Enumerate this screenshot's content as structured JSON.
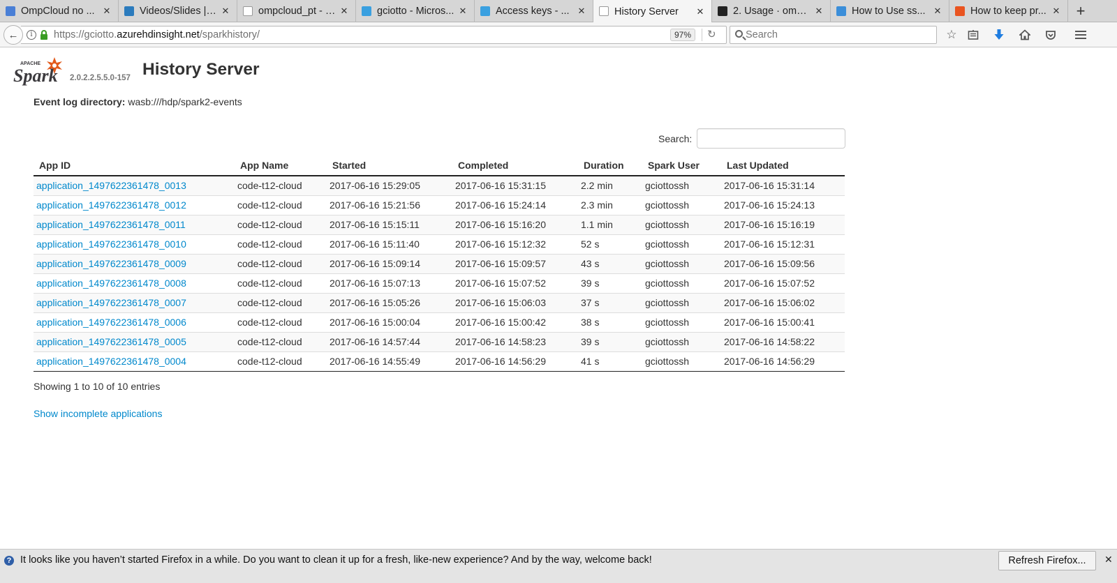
{
  "browser": {
    "tabs": [
      {
        "label": "OmpCloud no ...",
        "icon": "google-docs-icon",
        "color": "#4a7fd6",
        "active": false
      },
      {
        "label": "Videos/Slides | ...",
        "icon": "drupal-icon",
        "color": "#2b7bbd",
        "active": false
      },
      {
        "label": "ompcloud_pt - om...",
        "icon": "blank-page-icon",
        "color": "#ffffff",
        "active": false
      },
      {
        "label": "gciotto - Micros...",
        "icon": "azure-cloud-icon",
        "color": "#3aa0e0",
        "active": false
      },
      {
        "label": "Access keys - ...",
        "icon": "azure-cloud-icon",
        "color": "#3aa0e0",
        "active": false
      },
      {
        "label": "History Server",
        "icon": "blank-page-icon",
        "color": "#ffffff",
        "active": true
      },
      {
        "label": "2. Usage · omp...",
        "icon": "github-icon",
        "color": "#222222",
        "active": false
      },
      {
        "label": "How to Use ss...",
        "icon": "lock-doc-icon",
        "color": "#3b8ed9",
        "active": false
      },
      {
        "label": "How to keep pr...",
        "icon": "askubuntu-icon",
        "color": "#e95420",
        "active": false
      }
    ],
    "url_prefix": "https://gciotto.",
    "url_host": "azurehdinsight.net",
    "url_path": "/sparkhistory/",
    "zoom": "97%",
    "search_placeholder": "Search"
  },
  "page": {
    "spark_version": "2.0.2.2.5.5.0-157",
    "title": "History Server",
    "event_log_label": "Event log directory:",
    "event_log_value": "wasb:///hdp/spark2-events",
    "search_label": "Search:",
    "columns": [
      "App ID",
      "App Name",
      "Started",
      "Completed",
      "Duration",
      "Spark User",
      "Last Updated"
    ],
    "rows": [
      [
        "application_1497622361478_0013",
        "code-t12-cloud",
        "2017-06-16 15:29:05",
        "2017-06-16 15:31:15",
        "2.2 min",
        "gciottossh",
        "2017-06-16 15:31:14"
      ],
      [
        "application_1497622361478_0012",
        "code-t12-cloud",
        "2017-06-16 15:21:56",
        "2017-06-16 15:24:14",
        "2.3 min",
        "gciottossh",
        "2017-06-16 15:24:13"
      ],
      [
        "application_1497622361478_0011",
        "code-t12-cloud",
        "2017-06-16 15:15:11",
        "2017-06-16 15:16:20",
        "1.1 min",
        "gciottossh",
        "2017-06-16 15:16:19"
      ],
      [
        "application_1497622361478_0010",
        "code-t12-cloud",
        "2017-06-16 15:11:40",
        "2017-06-16 15:12:32",
        "52 s",
        "gciottossh",
        "2017-06-16 15:12:31"
      ],
      [
        "application_1497622361478_0009",
        "code-t12-cloud",
        "2017-06-16 15:09:14",
        "2017-06-16 15:09:57",
        "43 s",
        "gciottossh",
        "2017-06-16 15:09:56"
      ],
      [
        "application_1497622361478_0008",
        "code-t12-cloud",
        "2017-06-16 15:07:13",
        "2017-06-16 15:07:52",
        "39 s",
        "gciottossh",
        "2017-06-16 15:07:52"
      ],
      [
        "application_1497622361478_0007",
        "code-t12-cloud",
        "2017-06-16 15:05:26",
        "2017-06-16 15:06:03",
        "37 s",
        "gciottossh",
        "2017-06-16 15:06:02"
      ],
      [
        "application_1497622361478_0006",
        "code-t12-cloud",
        "2017-06-16 15:00:04",
        "2017-06-16 15:00:42",
        "38 s",
        "gciottossh",
        "2017-06-16 15:00:41"
      ],
      [
        "application_1497622361478_0005",
        "code-t12-cloud",
        "2017-06-16 14:57:44",
        "2017-06-16 14:58:23",
        "39 s",
        "gciottossh",
        "2017-06-16 14:58:22"
      ],
      [
        "application_1497622361478_0004",
        "code-t12-cloud",
        "2017-06-16 14:55:49",
        "2017-06-16 14:56:29",
        "41 s",
        "gciottossh",
        "2017-06-16 14:56:29"
      ]
    ],
    "showing_text": "Showing 1 to 10 of 10 entries",
    "incomplete_link": "Show incomplete applications",
    "link_color": "#0088cc"
  },
  "notification": {
    "message": "It looks like you haven’t started Firefox in a while. Do you want to clean it up for a fresh, like-new experience? And by the way, welcome back!",
    "button": "Refresh Firefox...",
    "close": "✕"
  }
}
